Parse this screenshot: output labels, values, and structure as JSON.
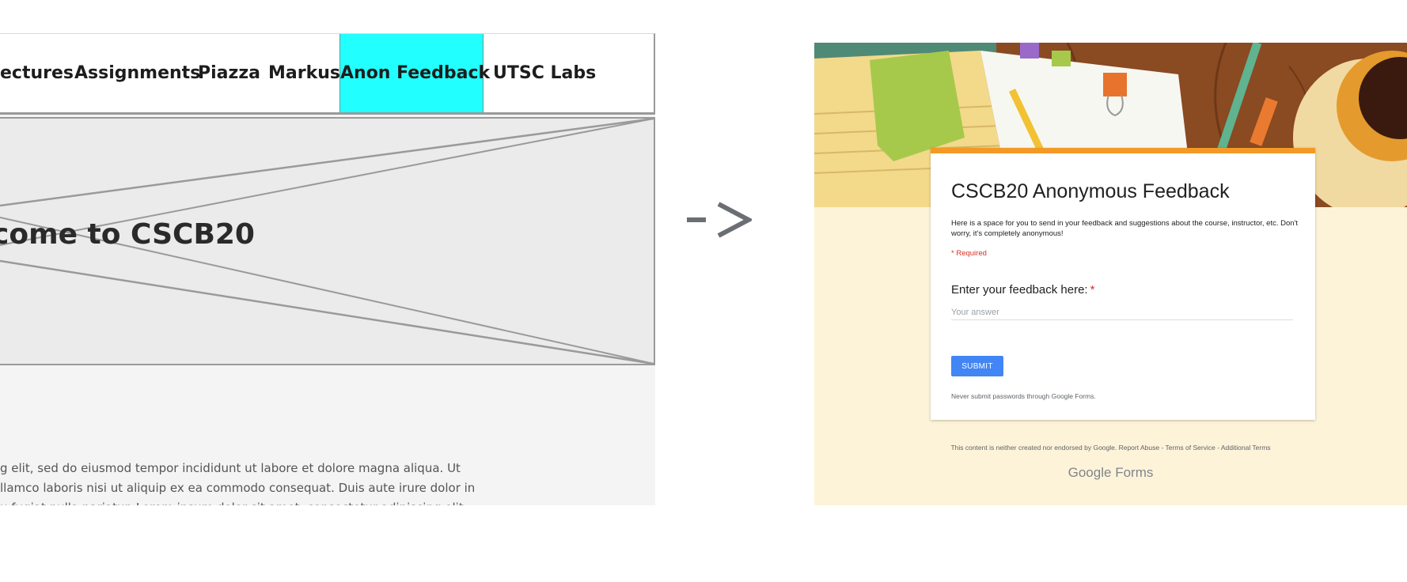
{
  "wireframe": {
    "nav": {
      "items": [
        {
          "label": "ectures"
        },
        {
          "label": "Assignments"
        },
        {
          "label": "Piazza"
        },
        {
          "label": "Markus"
        },
        {
          "label": "Anon Feedback",
          "active": true
        },
        {
          "label": "UTSC Labs"
        }
      ]
    },
    "hero_title": "come to CSCB20",
    "lorem_lines": [
      "g elit, sed do eiusmod tempor incididunt ut labore et dolore magna aliqua. Ut",
      "llamco laboris nisi ut aliquip ex ea commodo consequat. Duis aute irure dolor in",
      "u fugiat nulla pariatur. Lorem ipsum dolor sit amet, consectetur adipiscing elit"
    ]
  },
  "arrow": {
    "icon": "right-arrow-icon"
  },
  "google_form": {
    "title": "CSCB20 Anonymous Feedback",
    "description": "Here is a space for you to send in your feedback and suggestions about the course, instructor, etc. Don't worry, it's completely anonymous!",
    "required_note": "* Required",
    "question": {
      "label": "Enter your feedback here:",
      "required_mark": "*",
      "placeholder": "Your answer"
    },
    "submit_label": "SUBMIT",
    "never_submit": "Never submit passwords through Google Forms.",
    "disclaimer": "This content is neither created nor endorsed by Google. Report Abuse - Terms of Service - Additional Terms",
    "brand": {
      "google": "Google",
      "forms": "Forms"
    },
    "colors": {
      "accent": "#f39a26",
      "submit": "#4285f4",
      "required": "#d93025",
      "background": "#fdf3d9"
    }
  },
  "colors": {
    "active_tab": "#22ffff"
  }
}
